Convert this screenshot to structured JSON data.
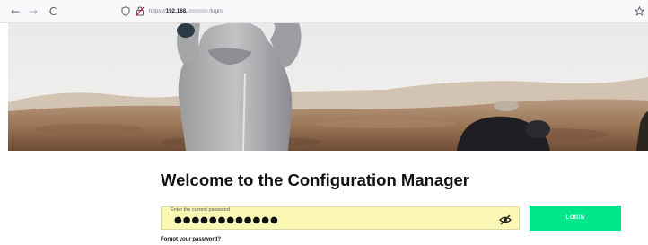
{
  "browser": {
    "back_glyph": "←",
    "forward_glyph": "→",
    "reload_glyph": "C",
    "url_prefix": "https://",
    "url_host": "192.168.",
    "url_path": "/login",
    "icons": [
      "back-arrow-icon",
      "forward-arrow-icon",
      "reload-icon",
      "shield-icon",
      "lock-icon",
      "star-icon"
    ]
  },
  "page": {
    "title": "Welcome to the Configuration Manager",
    "password": {
      "label": "Enter the current password",
      "masked_value": "●●●●●●●●●●●●"
    },
    "login_label": "LOGIN",
    "forgot_label": "Forgot your password?"
  },
  "colors": {
    "accent": "#01e68a",
    "field_bg": "#fbf8b6",
    "title": "#111111"
  }
}
